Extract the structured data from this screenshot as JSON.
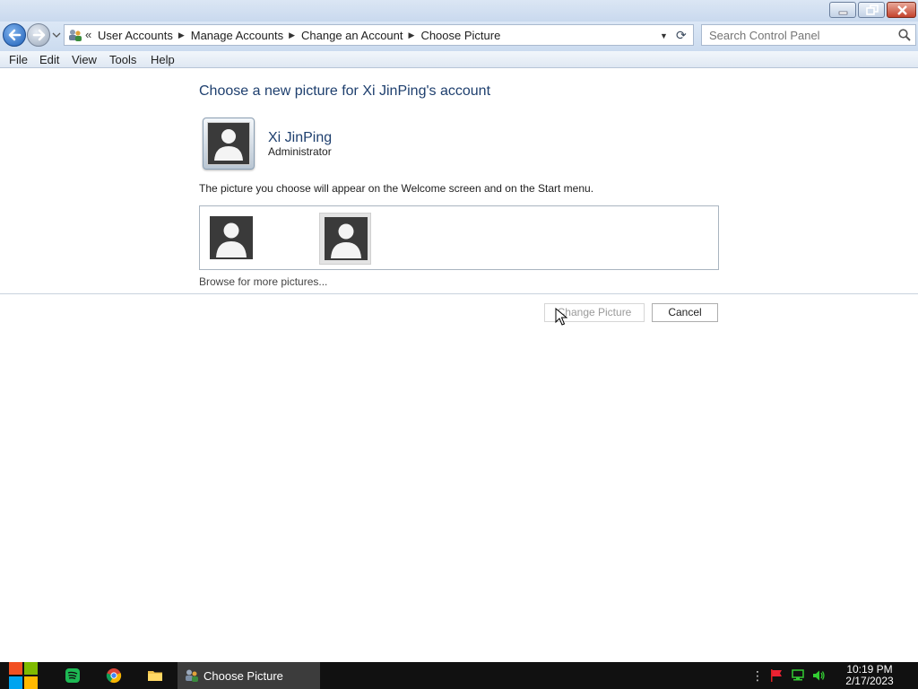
{
  "window": {
    "minimize_label": "minimize",
    "maximize_label": "maximize",
    "close_label": "close"
  },
  "address_bar": {
    "overflow": "«",
    "crumbs": [
      "User Accounts",
      "Manage Accounts",
      "Change an Account",
      "Choose Picture"
    ]
  },
  "search": {
    "placeholder": "Search Control Panel"
  },
  "menu": {
    "file": "File",
    "edit": "Edit",
    "view": "View",
    "tools": "Tools",
    "help": "Help"
  },
  "main": {
    "title": "Choose a new picture for Xi JinPing's account",
    "user_name": "Xi JinPing",
    "user_role": "Administrator",
    "hint": "The picture you choose will appear on the Welcome screen and on the Start menu.",
    "pictures": [
      {
        "name": "default user picture 1",
        "selected": false
      },
      {
        "name": "default user picture 2",
        "selected": true
      }
    ],
    "browse_link": "Browse for more pictures...",
    "change_button": "Change Picture",
    "cancel_button": "Cancel"
  },
  "taskbar": {
    "active_task": "Choose Picture",
    "time": "10:19 PM",
    "date": "2/17/2023"
  },
  "colors": {
    "title_text": "#1e3f6e",
    "taskbar_bg": "#111111",
    "task_active_bg": "#3c3c3c"
  }
}
